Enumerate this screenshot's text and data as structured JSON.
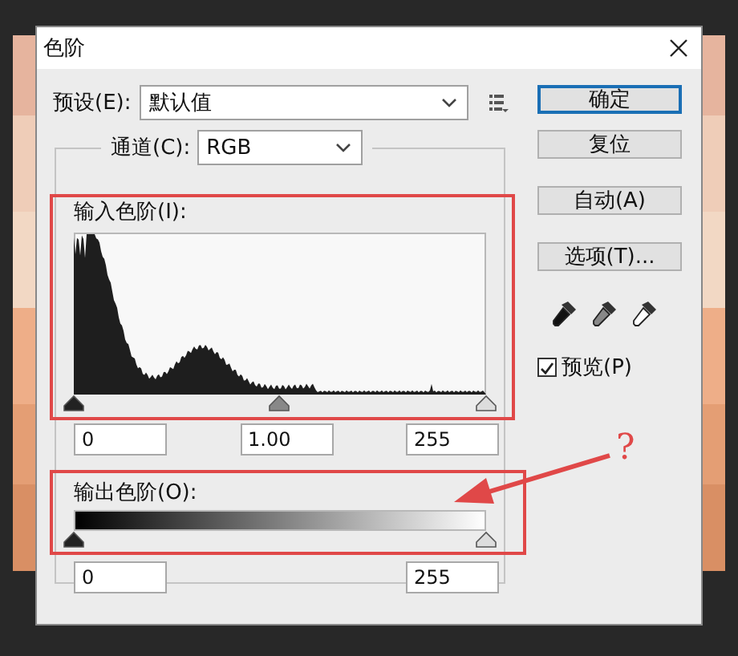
{
  "window": {
    "title": "色阶"
  },
  "preset": {
    "label": "预设(E):",
    "value": "默认值"
  },
  "channel": {
    "label": "通道(C):",
    "value": "RGB"
  },
  "input_levels": {
    "label": "输入色阶(I):",
    "fields": [
      "0",
      "1.00",
      "255"
    ]
  },
  "output_levels": {
    "label": "输出色阶(O):",
    "fields": [
      "0",
      "255"
    ]
  },
  "buttons": [
    {
      "label": "确定",
      "default": true
    },
    {
      "label": "复位",
      "default": false
    },
    {
      "label": "自动(A)",
      "default": false
    },
    {
      "label": "选项(T)...",
      "default": false
    }
  ],
  "preview": {
    "label": "预览(P)",
    "checked": true
  },
  "annotation": {
    "mark": "?"
  }
}
